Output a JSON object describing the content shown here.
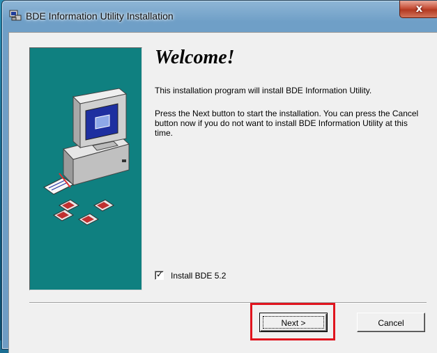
{
  "window": {
    "title": "BDE Information Utility Installation",
    "close_label": "x"
  },
  "content": {
    "heading": "Welcome!",
    "paragraph_1": "This installation program will install BDE Information Utility.",
    "paragraph_2": "Press the Next button to start the installation. You can press the Cancel button now if you do not want to install BDE Information Utility at this time."
  },
  "options": {
    "install_bde_label": "Install BDE 5.2",
    "install_bde_checked": true
  },
  "buttons": {
    "next_label": "Next >",
    "cancel_label": "Cancel"
  },
  "colors": {
    "art_background": "#0f8080",
    "highlight": "#e0141e"
  },
  "icons": {
    "title": "installer-icon",
    "art": "computer-with-disks-illustration"
  }
}
